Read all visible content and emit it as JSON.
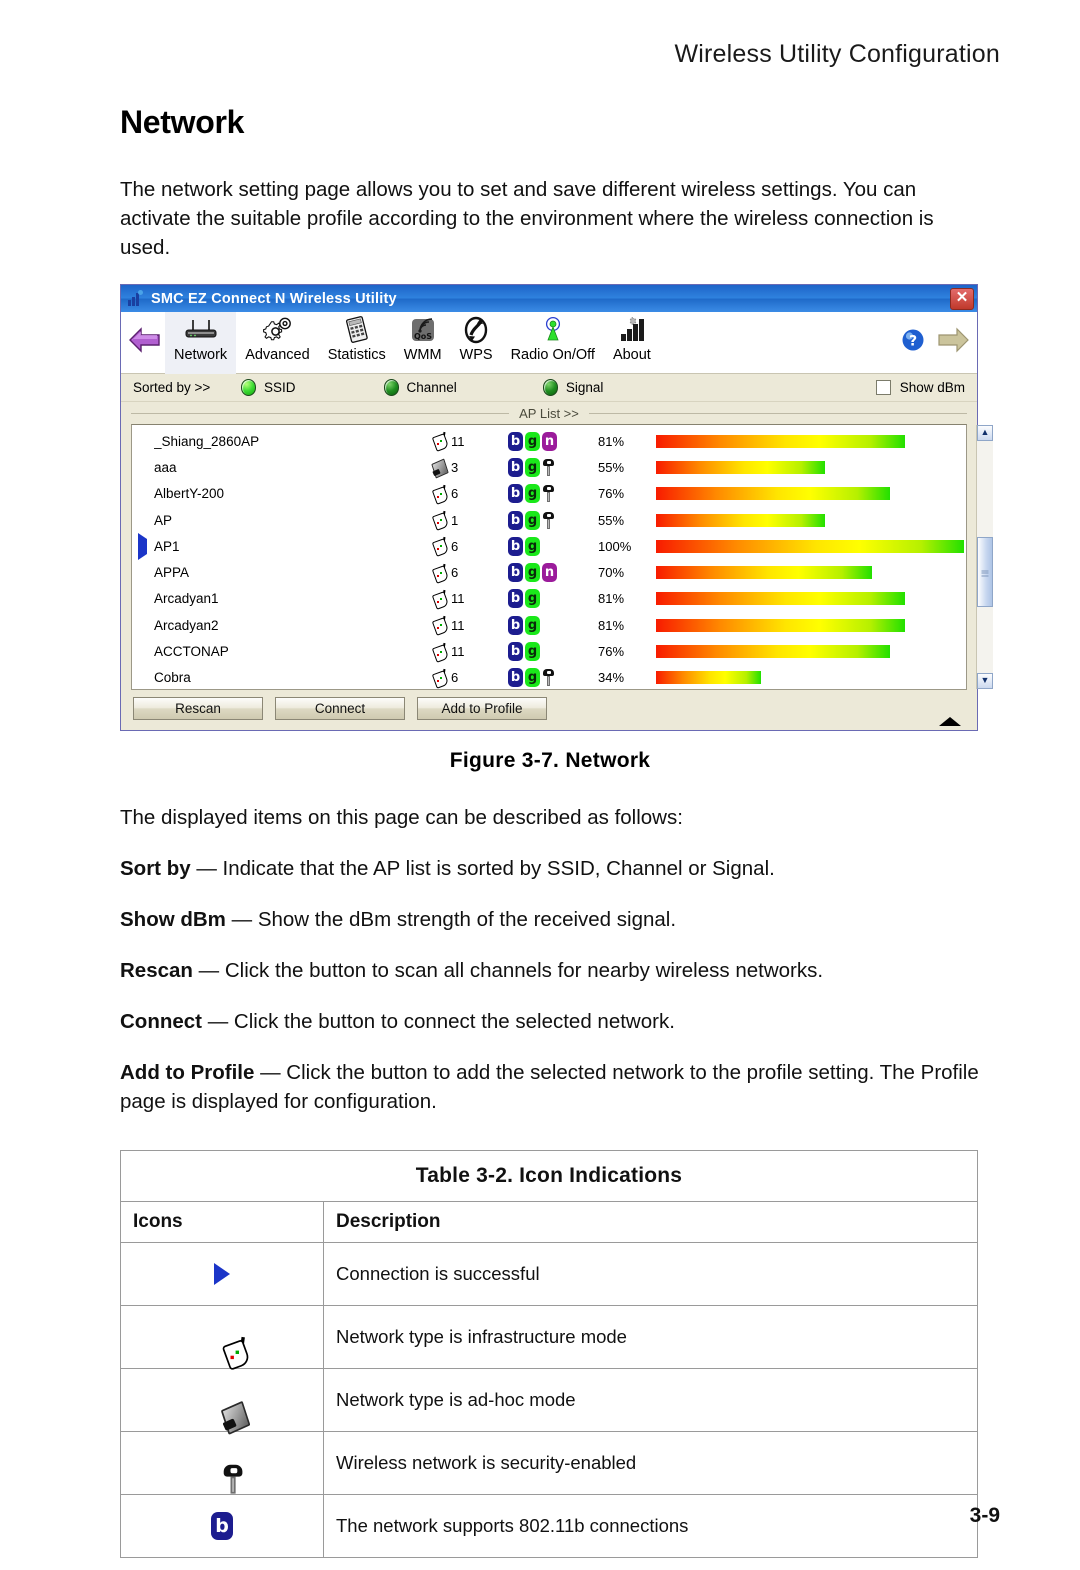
{
  "page": {
    "header": "Wireless Utility Configuration",
    "footer": "3-9"
  },
  "section": {
    "title": "Network",
    "intro": "The network setting page allows you to set and save different wireless settings. You can activate the suitable profile according to the environment where the wireless connection is used.",
    "figure_caption": "Figure 3-7.  Network",
    "items_intro": "The displayed items on this page can be described as follows:"
  },
  "definitions": [
    {
      "term": "Sort by",
      "dash": " — ",
      "text": "Indicate that the AP list is sorted by SSID, Channel or Signal."
    },
    {
      "term": "Show dBm",
      "dash": " — ",
      "text": "Show the dBm strength of the received signal."
    },
    {
      "term": "Rescan",
      "dash": " — ",
      "text": "Click the button to scan all channels for nearby wireless networks."
    },
    {
      "term": "Connect",
      "dash": " — ",
      "text": "Click the button to connect the selected network."
    },
    {
      "term": "Add to Profile",
      "dash": " — ",
      "text": "Click the button to add the selected network to the profile setting. The Profile page is displayed for configuration."
    }
  ],
  "app": {
    "title": "SMC EZ Connect N Wireless Utility",
    "close_label": "✕",
    "toolbar": {
      "prev_icon": "left-arrow-icon",
      "next_icon": "right-arrow-icon",
      "help_icon": "help-icon",
      "items": [
        {
          "label": "Network",
          "icon": "router-icon",
          "selected": true
        },
        {
          "label": "Advanced",
          "icon": "gears-icon",
          "selected": false
        },
        {
          "label": "Statistics",
          "icon": "keypad-icon",
          "selected": false
        },
        {
          "label": "WMM",
          "icon": "qos-icon",
          "selected": false
        },
        {
          "label": "WPS",
          "icon": "wps-icon",
          "selected": false
        },
        {
          "label": "Radio On/Off",
          "icon": "antenna-icon",
          "selected": false
        },
        {
          "label": "About",
          "icon": "bars-icon",
          "selected": false
        }
      ]
    },
    "sort_bar": {
      "label": "Sorted by >>",
      "options": [
        {
          "label": "SSID",
          "selected": true
        },
        {
          "label": "Channel",
          "selected": false
        },
        {
          "label": "Signal",
          "selected": false
        }
      ],
      "show_dbm_label": "Show dBm",
      "show_dbm_checked": false
    },
    "ap_list_header": "AP List >>",
    "ap_list": [
      {
        "ssid": "_Shiang_2860AP",
        "net_type": "infrastructure",
        "channel": "11",
        "caps": [
          "b",
          "g",
          "n"
        ],
        "secured": false,
        "signal": "81%",
        "signal_value": 81
      },
      {
        "ssid": "aaa",
        "net_type": "adhoc",
        "channel": "3",
        "caps": [
          "b",
          "g"
        ],
        "secured": true,
        "signal": "55%",
        "signal_value": 55
      },
      {
        "ssid": "AlbertY-200",
        "net_type": "infrastructure",
        "channel": "6",
        "caps": [
          "b",
          "g"
        ],
        "secured": true,
        "signal": "76%",
        "signal_value": 76
      },
      {
        "ssid": "AP",
        "net_type": "infrastructure",
        "channel": "1",
        "caps": [
          "b",
          "g"
        ],
        "secured": true,
        "signal": "55%",
        "signal_value": 55
      },
      {
        "ssid": "AP1",
        "net_type": "infrastructure",
        "channel": "6",
        "caps": [
          "b",
          "g"
        ],
        "secured": false,
        "signal": "100%",
        "signal_value": 100,
        "connected": true
      },
      {
        "ssid": "APPA",
        "net_type": "infrastructure",
        "channel": "6",
        "caps": [
          "b",
          "g",
          "n"
        ],
        "secured": false,
        "signal": "70%",
        "signal_value": 70
      },
      {
        "ssid": "Arcadyan1",
        "net_type": "infrastructure",
        "channel": "11",
        "caps": [
          "b",
          "g"
        ],
        "secured": false,
        "signal": "81%",
        "signal_value": 81
      },
      {
        "ssid": "Arcadyan2",
        "net_type": "infrastructure",
        "channel": "11",
        "caps": [
          "b",
          "g"
        ],
        "secured": false,
        "signal": "81%",
        "signal_value": 81
      },
      {
        "ssid": "ACCTONAP",
        "net_type": "infrastructure",
        "channel": "11",
        "caps": [
          "b",
          "g"
        ],
        "secured": false,
        "signal": "76%",
        "signal_value": 76
      },
      {
        "ssid": "Cobra",
        "net_type": "infrastructure",
        "channel": "6",
        "caps": [
          "b",
          "g"
        ],
        "secured": true,
        "signal": "34%",
        "signal_value": 34
      }
    ],
    "buttons": [
      {
        "label": "Rescan"
      },
      {
        "label": "Connect"
      },
      {
        "label": "Add to Profile"
      }
    ]
  },
  "icon_table": {
    "title": "Table 3-2. Icon Indications",
    "columns": [
      "Icons",
      "Description"
    ],
    "rows": [
      {
        "icon": "blue-triangle-icon",
        "description": "Connection is successful"
      },
      {
        "icon": "infrastructure-icon",
        "description": "Network type is infrastructure mode"
      },
      {
        "icon": "adhoc-icon",
        "description": "Network type is ad-hoc mode"
      },
      {
        "icon": "key-icon",
        "description": "Wireless network is security-enabled"
      },
      {
        "icon": "cap-b-icon",
        "description": "The network supports 802.11b connections"
      }
    ]
  },
  "colors": {
    "titlebar": "#2f82de",
    "selection_triangle": "#1b35c8",
    "cap_b": "#1d1d8f",
    "cap_g": "#1ae81a",
    "cap_n": "#9b1b9b",
    "window_face": "#ece9d8"
  }
}
